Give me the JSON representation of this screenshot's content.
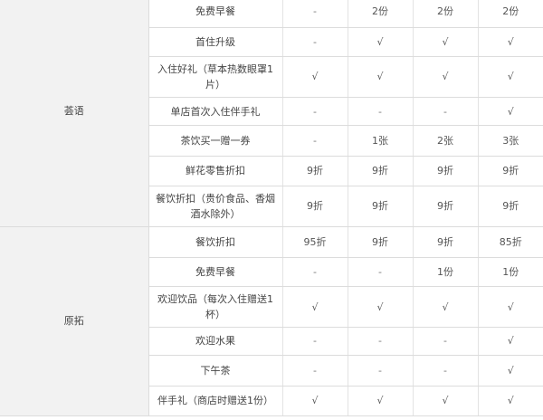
{
  "groups": [
    {
      "brand": "荟语",
      "rows": [
        {
          "benefit": "免费早餐",
          "values": [
            "-",
            "2份",
            "2份",
            "2份"
          ]
        },
        {
          "benefit": "首住升级",
          "values": [
            "-",
            "√",
            "√",
            "√"
          ]
        },
        {
          "benefit": "入住好礼（草本热数眼罩1片）",
          "values": [
            "√",
            "√",
            "√",
            "√"
          ]
        },
        {
          "benefit": "单店首次入住伴手礼",
          "values": [
            "-",
            "-",
            "-",
            "√"
          ]
        },
        {
          "benefit": "茶饮买一赠一券",
          "values": [
            "-",
            "1张",
            "2张",
            "3张"
          ]
        },
        {
          "benefit": "鲜花零售折扣",
          "values": [
            "9折",
            "9折",
            "9折",
            "9折"
          ]
        },
        {
          "benefit": "餐饮折扣（贵价食品、香烟酒水除外）",
          "values": [
            "9折",
            "9折",
            "9折",
            "9折"
          ]
        }
      ]
    },
    {
      "brand": "原拓",
      "rows": [
        {
          "benefit": "餐饮折扣",
          "values": [
            "95折",
            "9折",
            "9折",
            "85折"
          ]
        },
        {
          "benefit": "免费早餐",
          "values": [
            "-",
            "-",
            "1份",
            "1份"
          ]
        },
        {
          "benefit": "欢迎饮品（每次入住赠送1杯）",
          "values": [
            "√",
            "√",
            "√",
            "√"
          ]
        },
        {
          "benefit": "欢迎水果",
          "values": [
            "-",
            "-",
            "-",
            "√"
          ]
        },
        {
          "benefit": "下午茶",
          "values": [
            "-",
            "-",
            "-",
            "√"
          ]
        },
        {
          "benefit": "伴手礼（商店时赠送1份）",
          "values": [
            "√",
            "√",
            "√",
            "√"
          ]
        }
      ]
    }
  ]
}
